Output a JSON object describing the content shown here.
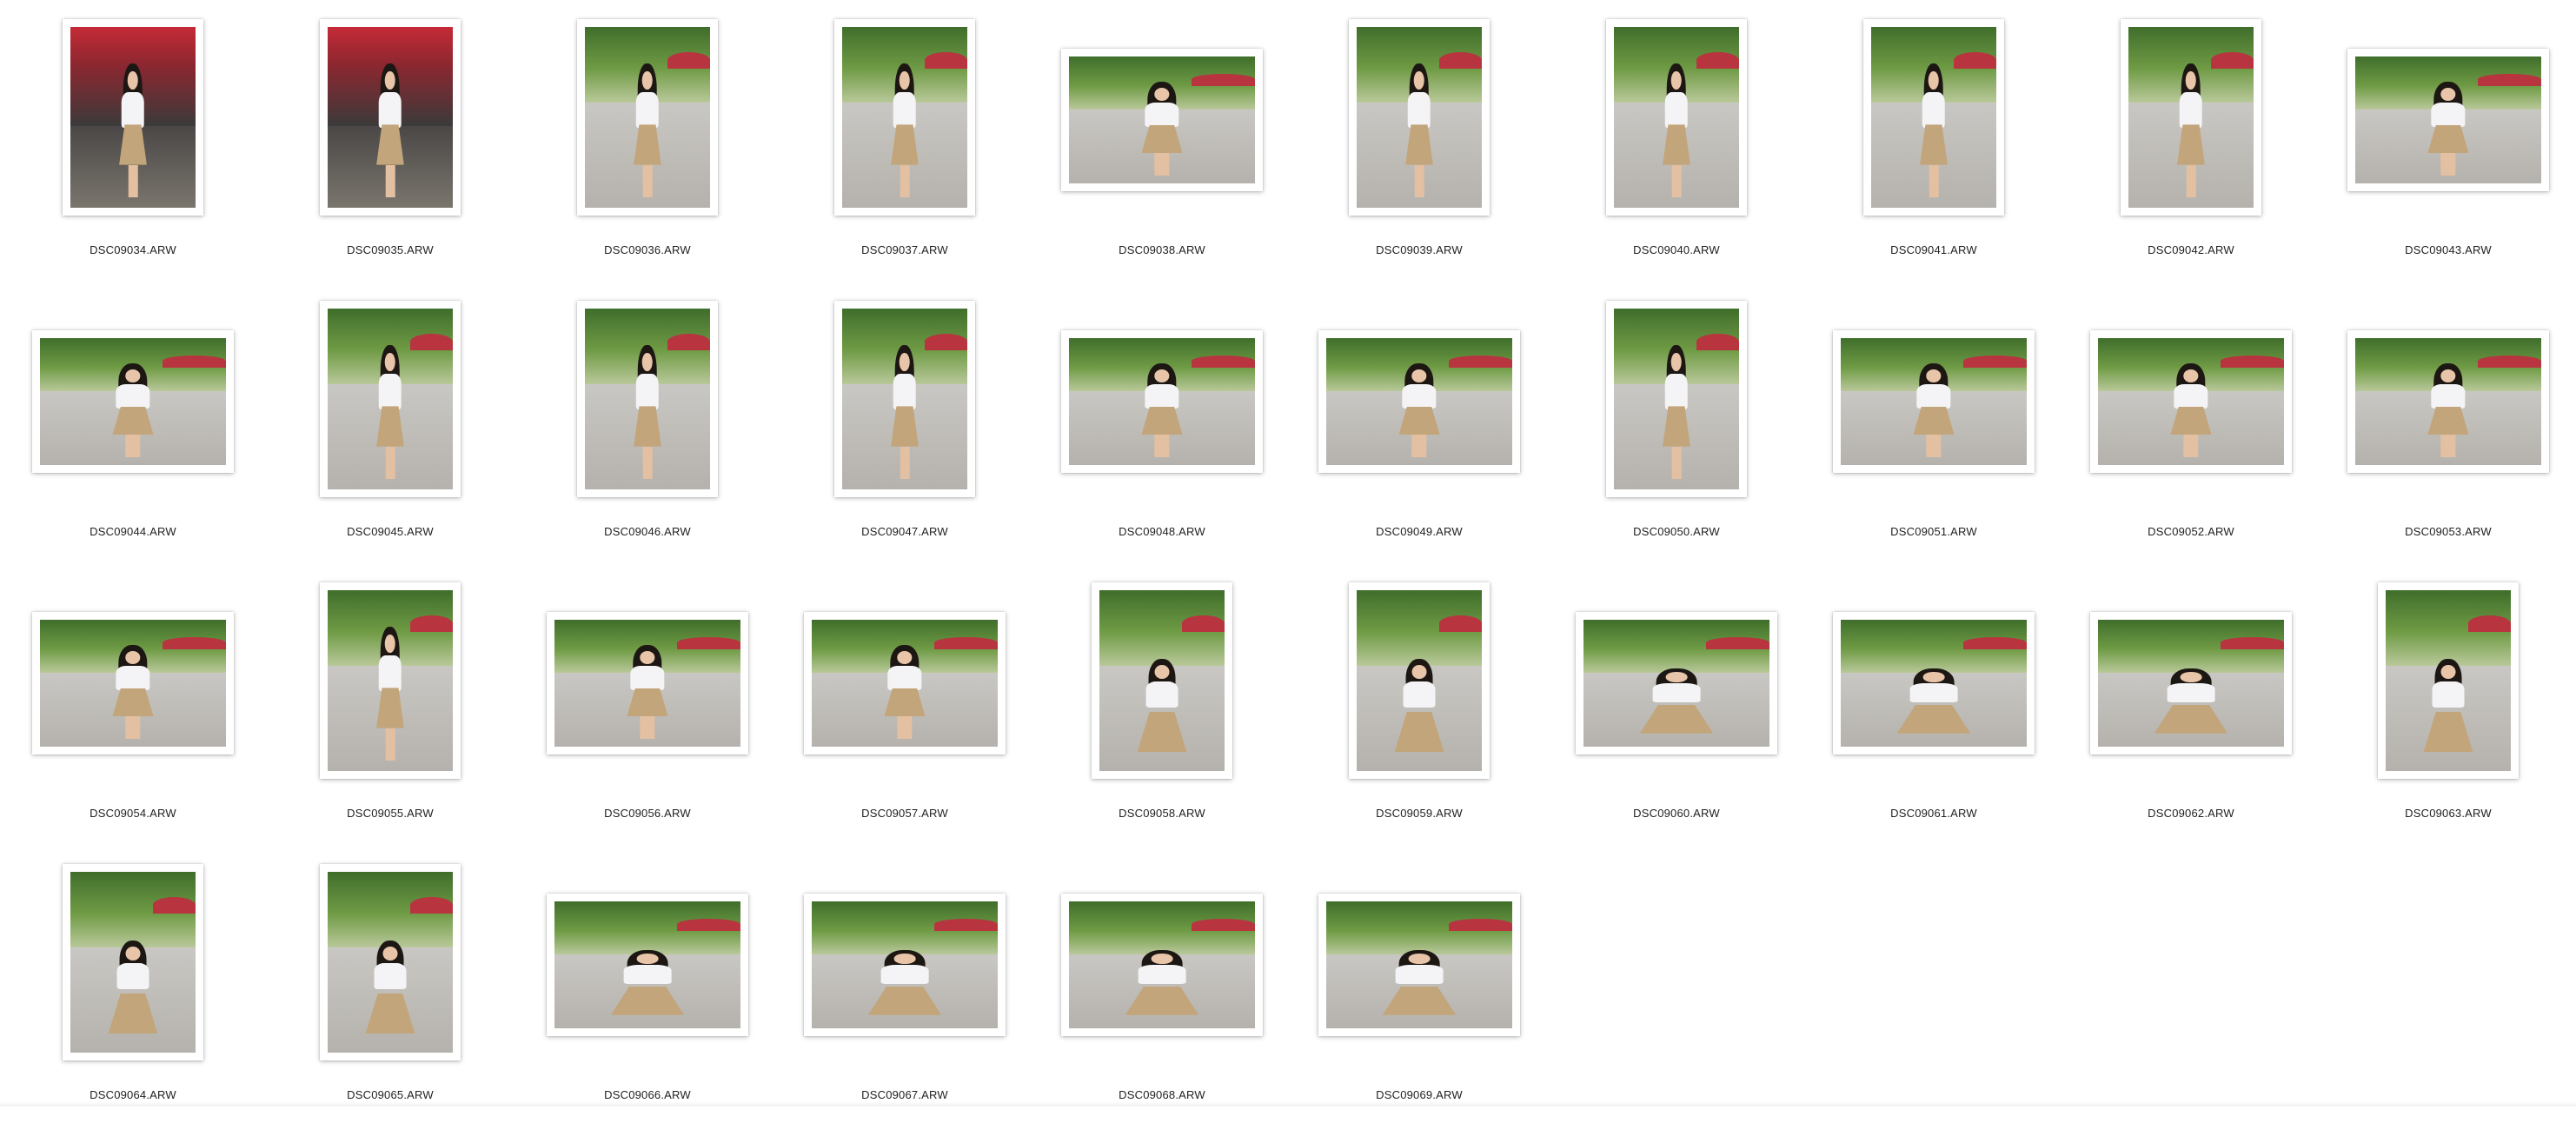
{
  "files": [
    {
      "name": "DSC09034.ARW",
      "orientation": "portrait",
      "scene": "red-bg"
    },
    {
      "name": "DSC09035.ARW",
      "orientation": "portrait",
      "scene": "red-bg"
    },
    {
      "name": "DSC09036.ARW",
      "orientation": "portrait",
      "scene": "standing"
    },
    {
      "name": "DSC09037.ARW",
      "orientation": "portrait",
      "scene": "standing"
    },
    {
      "name": "DSC09038.ARW",
      "orientation": "landscape",
      "scene": "standing"
    },
    {
      "name": "DSC09039.ARW",
      "orientation": "portrait",
      "scene": "standing"
    },
    {
      "name": "DSC09040.ARW",
      "orientation": "portrait",
      "scene": "standing"
    },
    {
      "name": "DSC09041.ARW",
      "orientation": "portrait",
      "scene": "standing"
    },
    {
      "name": "DSC09042.ARW",
      "orientation": "portrait",
      "scene": "standing"
    },
    {
      "name": "DSC09043.ARW",
      "orientation": "landscape",
      "scene": "standing"
    },
    {
      "name": "DSC09044.ARW",
      "orientation": "landscape",
      "scene": "standing"
    },
    {
      "name": "DSC09045.ARW",
      "orientation": "portrait",
      "scene": "standing"
    },
    {
      "name": "DSC09046.ARW",
      "orientation": "portrait",
      "scene": "standing"
    },
    {
      "name": "DSC09047.ARW",
      "orientation": "portrait",
      "scene": "standing"
    },
    {
      "name": "DSC09048.ARW",
      "orientation": "landscape",
      "scene": "standing"
    },
    {
      "name": "DSC09049.ARW",
      "orientation": "landscape",
      "scene": "standing"
    },
    {
      "name": "DSC09050.ARW",
      "orientation": "portrait",
      "scene": "standing"
    },
    {
      "name": "DSC09051.ARW",
      "orientation": "landscape",
      "scene": "standing"
    },
    {
      "name": "DSC09052.ARW",
      "orientation": "landscape",
      "scene": "standing"
    },
    {
      "name": "DSC09053.ARW",
      "orientation": "landscape",
      "scene": "standing"
    },
    {
      "name": "DSC09054.ARW",
      "orientation": "landscape",
      "scene": "standing"
    },
    {
      "name": "DSC09055.ARW",
      "orientation": "portrait",
      "scene": "standing"
    },
    {
      "name": "DSC09056.ARW",
      "orientation": "landscape",
      "scene": "standing"
    },
    {
      "name": "DSC09057.ARW",
      "orientation": "landscape",
      "scene": "standing"
    },
    {
      "name": "DSC09058.ARW",
      "orientation": "portrait",
      "scene": "sitting"
    },
    {
      "name": "DSC09059.ARW",
      "orientation": "portrait",
      "scene": "sitting"
    },
    {
      "name": "DSC09060.ARW",
      "orientation": "landscape",
      "scene": "sitting"
    },
    {
      "name": "DSC09061.ARW",
      "orientation": "landscape",
      "scene": "sitting"
    },
    {
      "name": "DSC09062.ARW",
      "orientation": "landscape",
      "scene": "sitting"
    },
    {
      "name": "DSC09063.ARW",
      "orientation": "portrait",
      "scene": "sitting"
    },
    {
      "name": "DSC09064.ARW",
      "orientation": "portrait",
      "scene": "sitting"
    },
    {
      "name": "DSC09065.ARW",
      "orientation": "portrait",
      "scene": "sitting"
    },
    {
      "name": "DSC09066.ARW",
      "orientation": "landscape",
      "scene": "sitting"
    },
    {
      "name": "DSC09067.ARW",
      "orientation": "landscape",
      "scene": "sitting"
    },
    {
      "name": "DSC09068.ARW",
      "orientation": "landscape",
      "scene": "sitting"
    },
    {
      "name": "DSC09069.ARW",
      "orientation": "landscape",
      "scene": "sitting"
    }
  ]
}
